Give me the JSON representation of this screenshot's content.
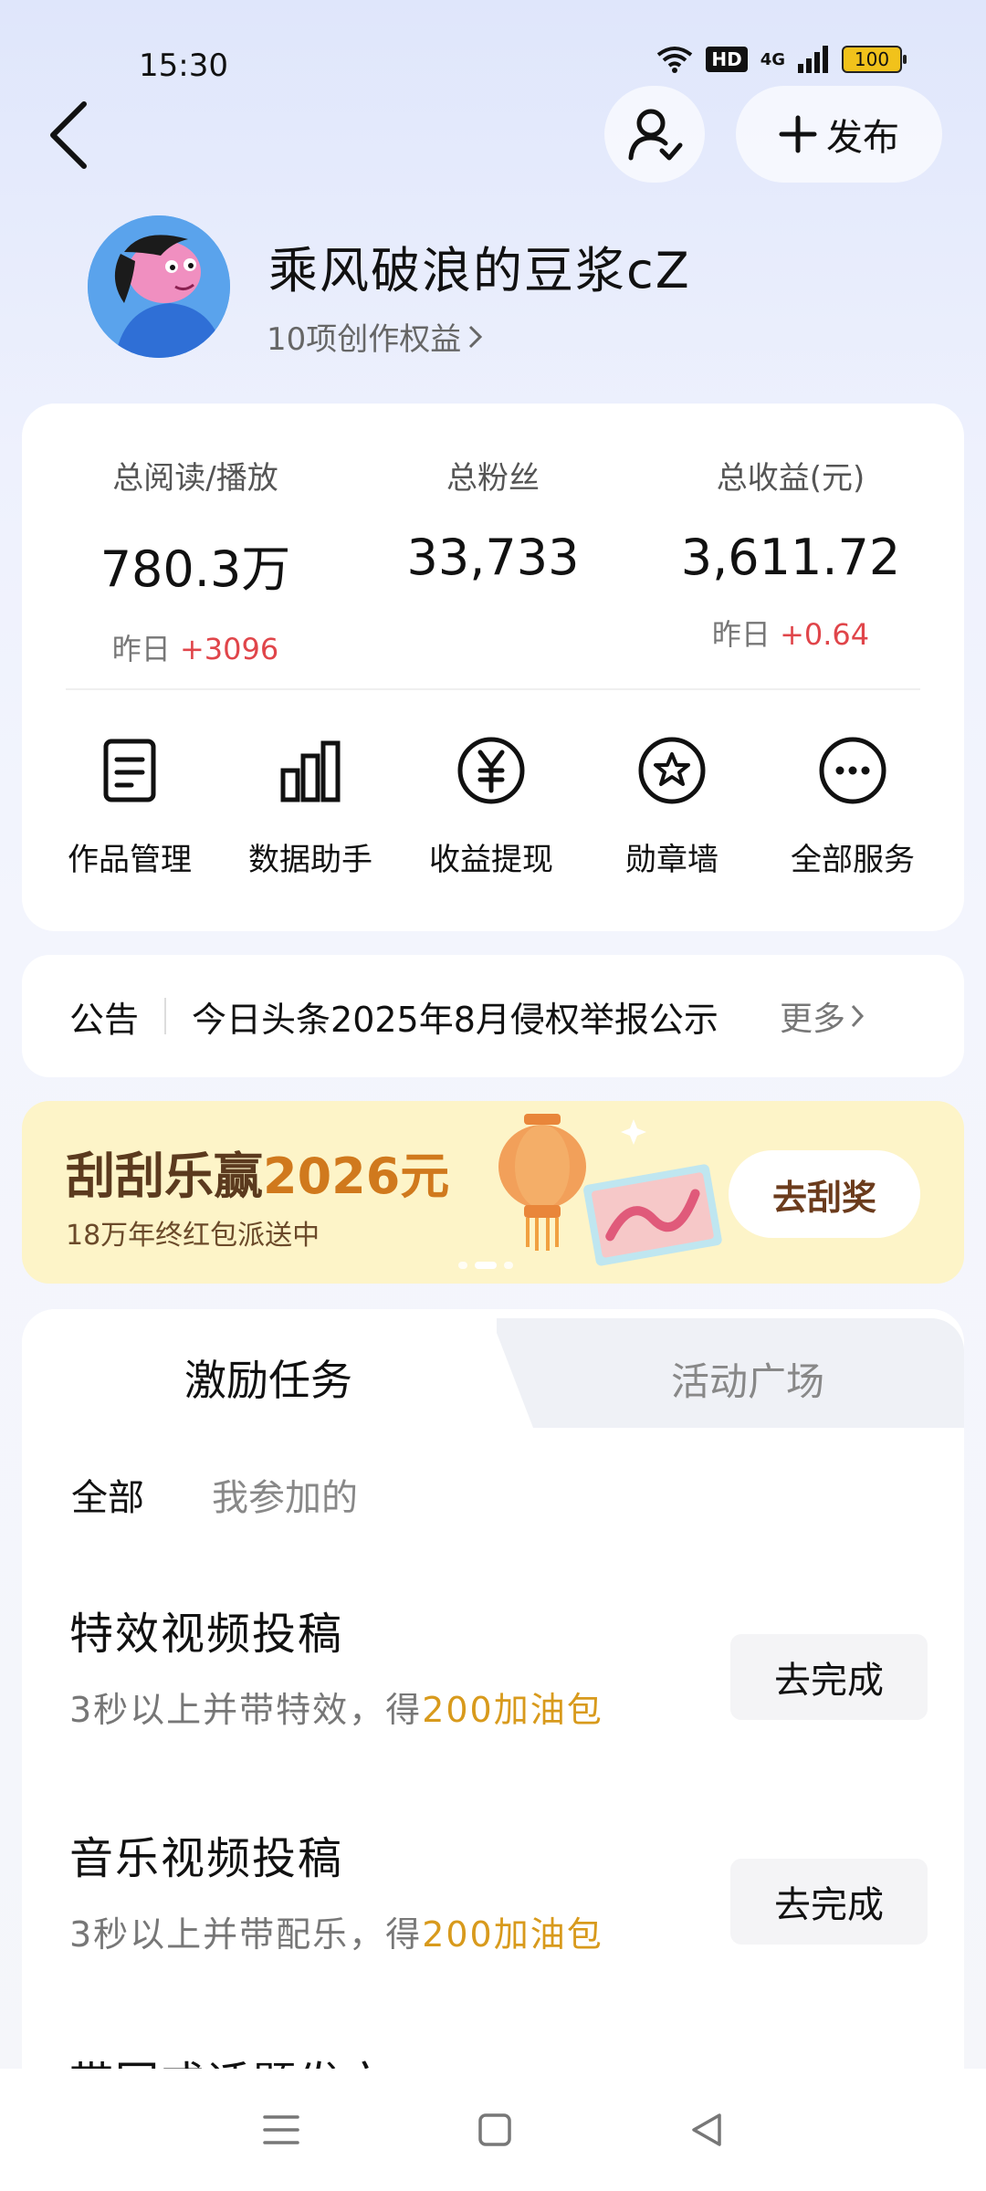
{
  "status_bar": {
    "time": "15:30",
    "hd": "HD",
    "network": "4G",
    "battery": "100",
    "icons": [
      "wifi-icon",
      "signal-icon",
      "battery-icon"
    ]
  },
  "header": {
    "publish_label": "发布",
    "icons": [
      "back-arrow-icon",
      "user-check-icon",
      "plus-icon"
    ]
  },
  "profile": {
    "username": "乘风破浪的豆浆cZ",
    "rights_link": "10项创作权益"
  },
  "stats": [
    {
      "label": "总阅读/播放",
      "value": "780.3万",
      "delta_prefix": "昨日",
      "delta": "+3096"
    },
    {
      "label": "总粉丝",
      "value": "33,733",
      "delta_prefix": "",
      "delta": ""
    },
    {
      "label": "总收益(元)",
      "value": "3,611.72",
      "delta_prefix": "昨日",
      "delta": "+0.64"
    }
  ],
  "services": [
    {
      "label": "作品管理",
      "icon": "document-icon"
    },
    {
      "label": "数据助手",
      "icon": "bar-chart-icon"
    },
    {
      "label": "收益提现",
      "icon": "yuan-coin-icon"
    },
    {
      "label": "勋章墙",
      "icon": "medal-star-icon"
    },
    {
      "label": "全部服务",
      "icon": "more-dots-icon"
    }
  ],
  "notice": {
    "title": "公告",
    "text": "今日头条2025年8月侵权举报公示",
    "more": "更多"
  },
  "banner": {
    "title_prefix": "刮刮乐赢",
    "title_amount": "2026元",
    "subtitle": "18万年终红包派送中",
    "button": "去刮奖"
  },
  "tasks": {
    "tabs": [
      "激励任务",
      "活动广场"
    ],
    "filters": [
      "全部",
      "我参加的"
    ],
    "items": [
      {
        "title": "特效视频投稿",
        "desc": "3秒以上并带特效，得",
        "reward": "200加油包",
        "button": "去完成"
      },
      {
        "title": "音乐视频投稿",
        "desc": "3秒以上并带配乐，得",
        "reward": "200加油包",
        "button": "去完成"
      }
    ],
    "partial_title": "带回或话题发文"
  },
  "colors": {
    "accent_red": "#e0454a",
    "reward_orange": "#d89a1c",
    "banner_bg": "#fdf4c8"
  }
}
